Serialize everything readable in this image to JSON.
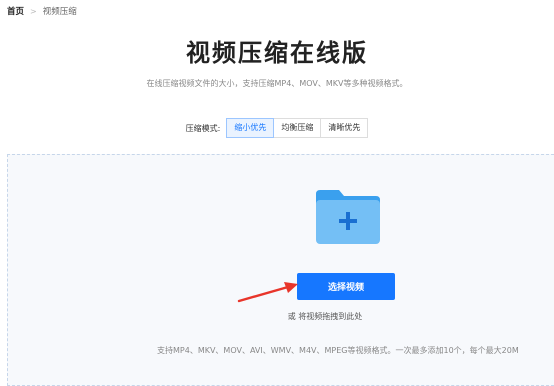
{
  "breadcrumb": {
    "home": "首页",
    "separator": ">",
    "current": "视频压缩"
  },
  "page": {
    "title": "视频压缩在线版",
    "subtitle": "在线压缩视频文件的大小，支持压缩MP4、MOV、MKV等多种视频格式。"
  },
  "compression_mode": {
    "label": "压缩模式:",
    "options": [
      {
        "label": "缩小优先",
        "selected": true
      },
      {
        "label": "均衡压缩",
        "selected": false
      },
      {
        "label": "清晰优先",
        "selected": false
      }
    ]
  },
  "upload": {
    "folder_icon": "folder-add-icon",
    "select_button": "选择视频",
    "drag_hint": "或 将视频拖拽到此处",
    "formats_note": "支持MP4、MKV、MOV、AVI、WMV、M4V、MPEG等视频格式。一次最多添加10个，每个最大20M"
  },
  "annotation": {
    "arrow_icon": "red-arrow-icon",
    "color": "#e8352a"
  },
  "colors": {
    "accent": "#1677ff",
    "folder_light": "#74bff5",
    "folder_dark": "#3aa0ee"
  }
}
